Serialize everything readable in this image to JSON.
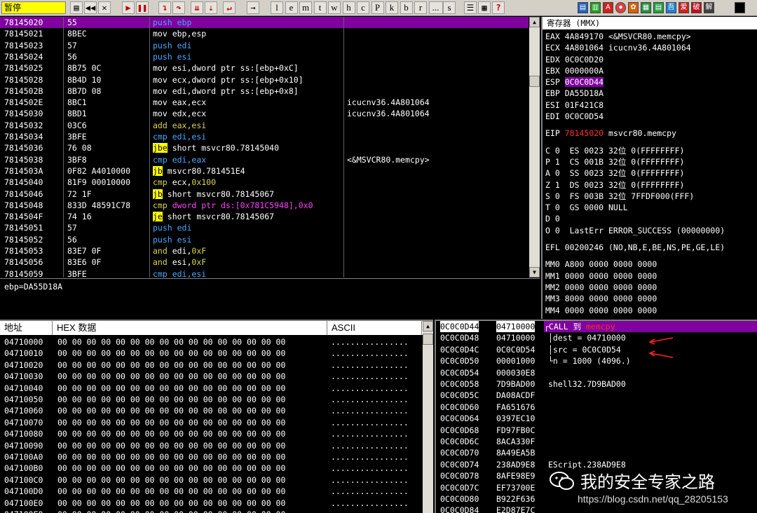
{
  "toolbar": {
    "status": "暂停",
    "letters": [
      "l",
      "e",
      "m",
      "t",
      "w",
      "h",
      "c",
      "P",
      "k",
      "b",
      "r",
      "...",
      "s"
    ],
    "right_buttons": [
      "吾",
      "爱",
      "破",
      "解"
    ]
  },
  "cpu": {
    "rows": [
      {
        "addr": "78145020",
        "hex": "55",
        "op": "push",
        "args": " ebp",
        "comment": "",
        "sel": true
      },
      {
        "addr": "78145021",
        "hex": "8BEC",
        "op": "mov",
        "args": " ebp,esp",
        "comment": ""
      },
      {
        "addr": "78145023",
        "hex": "57",
        "op": "push",
        "args": " edi",
        "comment": ""
      },
      {
        "addr": "78145024",
        "hex": "56",
        "op": "push",
        "args": " esi",
        "comment": ""
      },
      {
        "addr": "78145025",
        "hex": "8B75 0C",
        "op": "mov",
        "args": " esi,dword ptr ss:[ebp+0xC]",
        "comment": ""
      },
      {
        "addr": "78145028",
        "hex": "8B4D 10",
        "op": "mov",
        "args": " ecx,dword ptr ss:[ebp+0x10]",
        "comment": ""
      },
      {
        "addr": "7814502B",
        "hex": "8B7D 08",
        "op": "mov",
        "args": " edi,dword ptr ss:[ebp+0x8]",
        "comment": ""
      },
      {
        "addr": "7814502E",
        "hex": "8BC1",
        "op": "mov",
        "args": " eax,ecx",
        "comment": "icucnv36.4A801064"
      },
      {
        "addr": "78145030",
        "hex": "8BD1",
        "op": "mov",
        "args": " edx,ecx",
        "comment": "icucnv36.4A801064"
      },
      {
        "addr": "78145032",
        "hex": "03C6",
        "op": "add",
        "args": " eax,esi",
        "comment": ""
      },
      {
        "addr": "78145034",
        "hex": "3BFE",
        "op": "cmp",
        "args": " edi,esi",
        "comment": ""
      },
      {
        "addr": "78145036",
        "hex": "76 08",
        "op": "jbe",
        "args": " short msvcr80.78145040",
        "comment": "",
        "jmp": true
      },
      {
        "addr": "78145038",
        "hex": "3BF8",
        "op": "cmp",
        "args": " edi,eax",
        "comment": "<&MSVCR80.memcpy>"
      },
      {
        "addr": "7814503A",
        "hex": "0F82 A4010000",
        "op": "jb",
        "args": " msvcr80.781451E4",
        "comment": "",
        "jmp": true
      },
      {
        "addr": "78145040",
        "hex": "81F9 00010000",
        "op": "cmp",
        "args": " ecx,0x100",
        "comment": ""
      },
      {
        "addr": "78145046",
        "hex": "72 1F",
        "op": "jb",
        "args": " short msvcr80.78145067",
        "comment": "",
        "jmp": true
      },
      {
        "addr": "78145048",
        "hex": "833D 48591C78",
        "op": "cmp",
        "args": " dword ptr ds:[0x781C5948],0x0",
        "comment": ""
      },
      {
        "addr": "7814504F",
        "hex": "74 16",
        "op": "je",
        "args": " short msvcr80.78145067",
        "comment": "",
        "jmp": true
      },
      {
        "addr": "78145051",
        "hex": "57",
        "op": "push",
        "args": " edi",
        "comment": ""
      },
      {
        "addr": "78145052",
        "hex": "56",
        "op": "push",
        "args": " esi",
        "comment": ""
      },
      {
        "addr": "78145053",
        "hex": "83E7 0F",
        "op": "and",
        "args": " edi,0xF",
        "comment": ""
      },
      {
        "addr": "78145056",
        "hex": "83E6 0F",
        "op": "and",
        "args": " esi,0xF",
        "comment": ""
      },
      {
        "addr": "78145059",
        "hex": "3BFE",
        "op": "cmp",
        "args": " edi,esi",
        "comment": ""
      }
    ]
  },
  "info": {
    "text": "ebp=DA55D18A"
  },
  "registers": {
    "header": "寄存器 (MMX)",
    "lines": [
      "EAX 4A849170 <&MSVCR80.memcpy>",
      "ECX 4A801064 icucnv36.4A801064",
      "EDX 0C0C0D20",
      "EBX 0000000A",
      "ESP|0C0C0D44",
      "EBP DA55D18A",
      "ESI 01F421C8",
      "EDI 0C0C0D54",
      "",
      "EIP|78145020| msvcr80.memcpy",
      "",
      "C 0  ES 0023 32位 0(FFFFFFFF)",
      "P 1  CS 001B 32位 0(FFFFFFFF)",
      "A 0  SS 0023 32位 0(FFFFFFFF)",
      "Z 1  DS 0023 32位 0(FFFFFFFF)",
      "S 0  FS 003B 32位 7FFDF000(FFF)",
      "T 0  GS 0000 NULL",
      "D 0",
      "O 0  LastErr ERROR_SUCCESS (00000000)",
      "",
      "EFL 00200246 (NO,NB,E,BE,NS,PE,GE,LE)",
      "",
      "MM0 A800 0000 0000 0000",
      "MM1 0000 0000 0000 0000",
      "MM2 0000 0000 0000 0000",
      "MM3 8000 0000 0000 0000",
      "MM4 0000 0000 0000 0000"
    ]
  },
  "dump": {
    "headers": [
      "地址",
      "HEX 数据",
      "ASCII"
    ],
    "hexline": "00 00 00 00 00 00 00 00 00 00 00 00 00 00 00 00",
    "asciiline": "................",
    "addrs": [
      "04710000",
      "04710010",
      "04710020",
      "04710030",
      "04710040",
      "04710050",
      "04710060",
      "04710070",
      "04710080",
      "04710090",
      "047100A0",
      "047100B0",
      "047100C0",
      "047100D0",
      "047100E0",
      "047100F0"
    ]
  },
  "stack": {
    "rows": [
      {
        "a": "0C0C0D44",
        "v": "04710000",
        "c": "┌CALL 到 memcpy",
        "sel": true
      },
      {
        "a": "0C0C0D48",
        "v": "04710000",
        "c": "│dest = 04710000"
      },
      {
        "a": "0C0C0D4C",
        "v": "0C0C0D54",
        "c": "│src = 0C0C0D54"
      },
      {
        "a": "0C0C0D50",
        "v": "00001000",
        "c": "└n = 1000 (4096.)"
      },
      {
        "a": "0C0C0D54",
        "v": "000030E8",
        "c": ""
      },
      {
        "a": "0C0C0D58",
        "v": "7D9BAD00",
        "c": "shell32.7D9BAD00"
      },
      {
        "a": "0C0C0D5C",
        "v": "DA08ACDF",
        "c": ""
      },
      {
        "a": "0C0C0D60",
        "v": "FA651676",
        "c": ""
      },
      {
        "a": "0C0C0D64",
        "v": "0397EC10",
        "c": ""
      },
      {
        "a": "0C0C0D68",
        "v": "FD97FB0C",
        "c": ""
      },
      {
        "a": "0C0C0D6C",
        "v": "8ACA330F",
        "c": ""
      },
      {
        "a": "0C0C0D70",
        "v": "8A49EA5B",
        "c": ""
      },
      {
        "a": "0C0C0D74",
        "v": "238AD9E8",
        "c": "EScript.238AD9E8"
      },
      {
        "a": "0C0C0D78",
        "v": "8AFE98E9",
        "c": ""
      },
      {
        "a": "0C0C0D7C",
        "v": "EF73700E",
        "c": ""
      },
      {
        "a": "0C0C0D80",
        "v": "B922F636",
        "c": ""
      },
      {
        "a": "0C0C0D84",
        "v": "E2D87E7C",
        "c": ""
      }
    ]
  },
  "watermark": {
    "title": "我的安全专家之路",
    "url": "https://blog.csdn.net/qq_28205153"
  }
}
